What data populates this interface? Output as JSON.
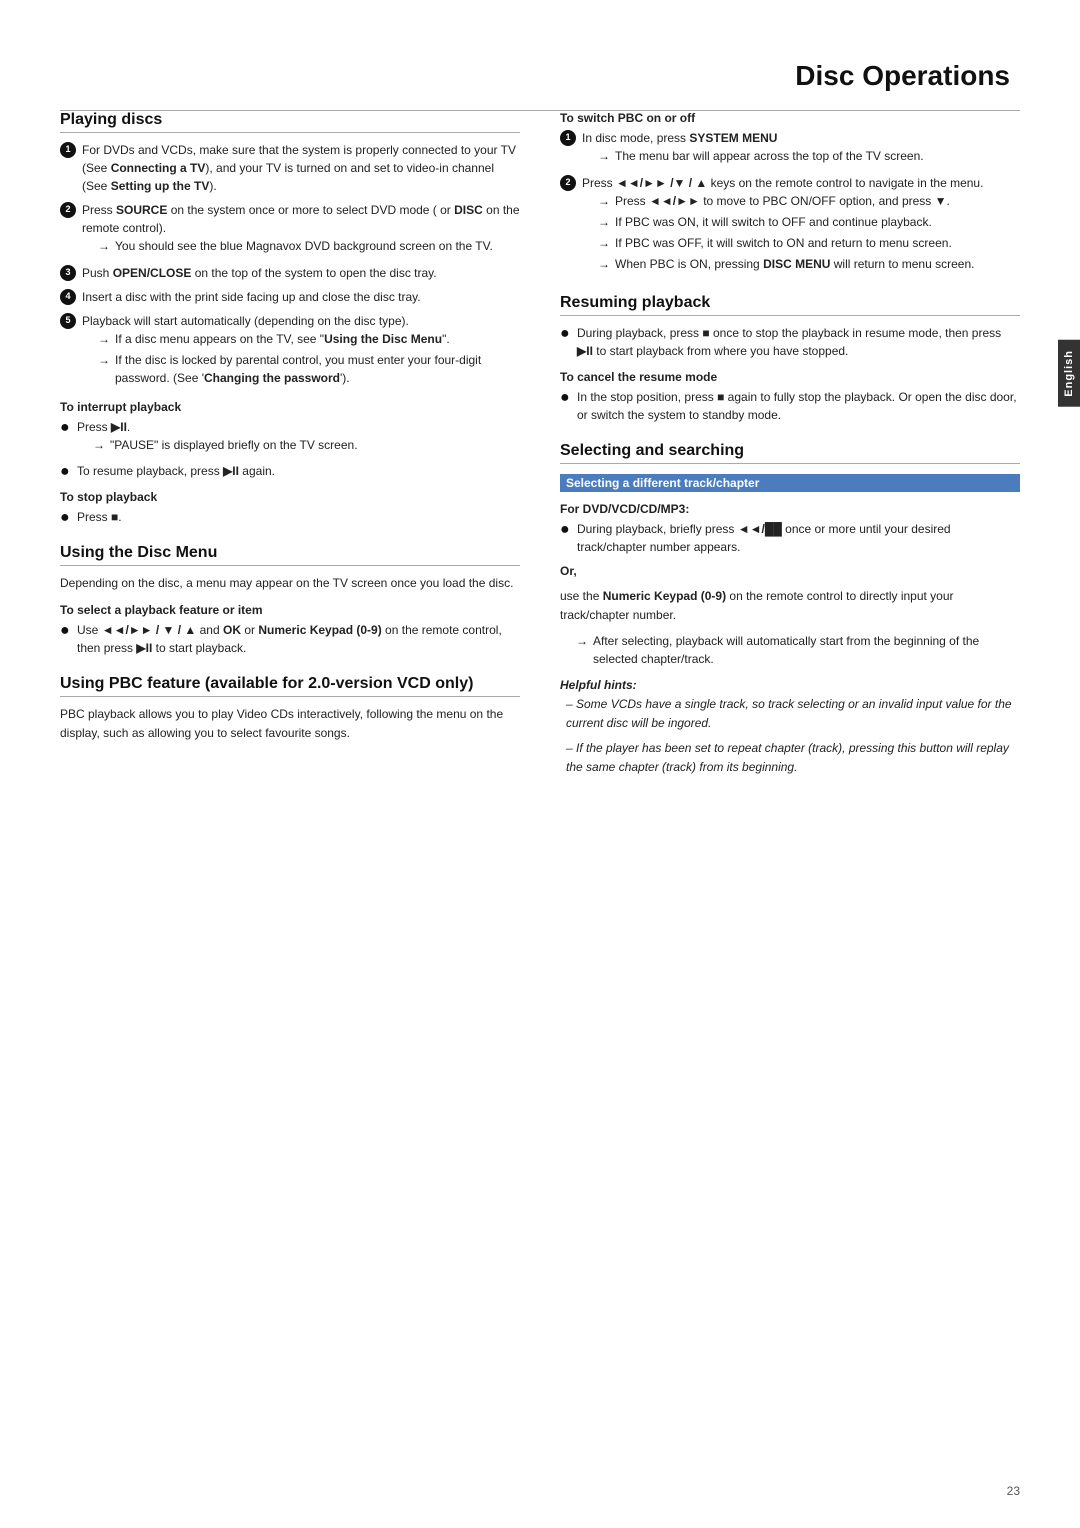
{
  "page": {
    "title": "Disc Operations",
    "page_number": "23"
  },
  "english_tab": "English",
  "left_column": {
    "playing_discs": {
      "header": "Playing discs",
      "items": [
        {
          "num": "1",
          "text": "For DVDs and VCDs, make sure that the system is properly connected to your TV (See ",
          "bold": "Connecting a TV",
          "text2": "), and your TV is turned on and set to video-in channel (See ",
          "bold2": "Setting up the TV",
          "text3": ")."
        },
        {
          "num": "2",
          "text_pre": "Press ",
          "bold": "SOURCE",
          "text": " on the system once or more to select DVD mode ( or ",
          "bold2": "DISC",
          "text2": " on the remote control).",
          "arrow": "You should see the blue Magnavox DVD background screen on the TV."
        },
        {
          "num": "3",
          "text_pre": "Push ",
          "bold": "OPEN/CLOSE",
          "text": " on the top of the system to open the disc tray."
        },
        {
          "num": "4",
          "text": "Insert a disc with the print side facing up and close the disc tray."
        },
        {
          "num": "5",
          "text": "Playback will start automatically (depending on the disc type).",
          "arrows": [
            "If a disc menu appears on the TV, see “Using the Disc Menu”.",
            "If the disc is locked by parental control, you must enter your four-digit password. (See ‘Changing the password’)."
          ]
        }
      ],
      "interrupt_playback": {
        "header": "To interrupt playback",
        "items": [
          {
            "type": "bullet",
            "text_pre": "Press ",
            "symbol": "▶II",
            "arrow": "“PAUSE” is displayed briefly on the TV screen."
          },
          {
            "type": "bullet",
            "text": "To resume playback, press ",
            "symbol": "▶II",
            "text2": " again."
          }
        ]
      },
      "stop_playback": {
        "header": "To stop playback",
        "items": [
          {
            "type": "bullet",
            "text_pre": "Press ",
            "symbol": "■"
          }
        ]
      }
    },
    "using_disc_menu": {
      "header": "Using the Disc Menu",
      "intro": "Depending on the disc, a menu may appear on the TV screen once you load the disc.",
      "select_item": {
        "header": "To select a playback feature or item",
        "items": [
          {
            "type": "bullet",
            "text": "Use ",
            "symbols": "◄◄/►► / ▼ / ▲",
            "text2": " and ",
            "bold": "OK",
            "text3": " or ",
            "bold2": "Numeric Keypad (0-9)",
            "text4": " on the remote control, then press ",
            "symbol": "▶II",
            "text5": " to start playback."
          }
        ]
      }
    },
    "using_pbc": {
      "header": "Using PBC feature (available for 2.0-version VCD only)",
      "intro": "PBC playback allows you to play Video CDs interactively, following the menu on the display, such as allowing you to select favourite songs."
    }
  },
  "right_column": {
    "switch_pbc": {
      "header": "To switch PBC on or off",
      "items": [
        {
          "num": "1",
          "text_pre": "In disc mode, press ",
          "bold": "SYSTEM MENU",
          "arrow": "The menu bar will appear across the top of the TV screen."
        },
        {
          "num": "2",
          "text_pre": "Press ",
          "symbols": "◄◄/►► /▼ / ▲",
          "text": " keys on the remote control to navigate in the menu.",
          "arrows": [
            "Press ◄◄/►► to move to PBC ON/OFF option, and press ▼.",
            "If PBC was ON, it will switch to OFF and continue playback.",
            "If PBC was OFF, it will switch to ON and return to menu screen.",
            "When PBC is ON, pressing DISC MENU will return to menu screen."
          ]
        }
      ]
    },
    "resuming_playback": {
      "header": "Resuming playback",
      "items": [
        {
          "type": "bullet",
          "text": "During playback, press ■ once to stop the playback in resume mode, then press ▶II to start playback from where you have stopped."
        }
      ],
      "cancel_resume": {
        "header": "To cancel the resume mode",
        "items": [
          {
            "type": "bullet",
            "text": "In the stop position, press ■ again to fully stop the playback. Or open the disc door, or switch the system to standby mode."
          }
        ]
      }
    },
    "selecting_searching": {
      "header": "Selecting and searching",
      "diff_track": {
        "header": "Selecting a different track/chapter",
        "for_dvd": {
          "header": "For DVD/VCD/CD/MP3:",
          "items": [
            {
              "type": "bullet",
              "text": "During playback, briefly press ◄◄/►► once or more until your desired track/chapter number appears."
            }
          ]
        },
        "or_section": {
          "label": "Or,",
          "text": "use the ",
          "bold": "Numeric Keypad (0-9)",
          "text2": " on the remote control to directly input your track/chapter number.",
          "arrow": "After selecting, playback will automatically start from the beginning of the selected chapter/track."
        },
        "helpful_hints": {
          "title": "Helpful hints:",
          "hints": [
            "– Some VCDs have a single track, so track selecting or an invalid input value for the current disc will be ingored.",
            "– If the player has been set to repeat chapter (track), pressing this button will replay the same chapter (track) from its beginning."
          ]
        }
      }
    }
  }
}
